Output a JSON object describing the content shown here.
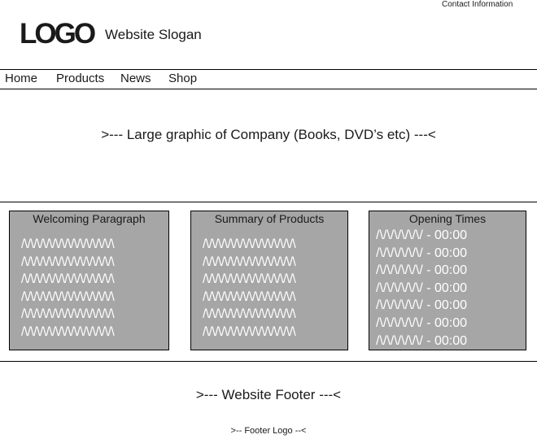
{
  "header": {
    "contact_label": "Contact Information",
    "logo_text": "LOGO",
    "slogan": "Website Slogan"
  },
  "nav": {
    "items": [
      {
        "label": "Home"
      },
      {
        "label": "Products"
      },
      {
        "label": "News"
      },
      {
        "label": "Shop"
      }
    ]
  },
  "hero": {
    "text": ">--- Large graphic of Company (Books, DVD’s etc) ---<"
  },
  "panels": [
    {
      "title": "Welcoming Paragraph",
      "lines": [
        "/\\/\\/\\/\\/\\/\\/\\/\\/\\/\\/\\/\\/\\/\\/\\",
        "/\\/\\/\\/\\/\\/\\/\\/\\/\\/\\/\\/\\/\\/\\/\\",
        "/\\/\\/\\/\\/\\/\\/\\/\\/\\/\\/\\/\\/\\/\\/\\",
        "/\\/\\/\\/\\/\\/\\/\\/\\/\\/\\/\\/\\/\\/\\/\\",
        "/\\/\\/\\/\\/\\/\\/\\/\\/\\/\\/\\/\\/\\/\\/\\",
        "/\\/\\/\\/\\/\\/\\/\\/\\/\\/\\/\\/\\/\\/\\/\\"
      ]
    },
    {
      "title": "Summary of Products",
      "lines": [
        "/\\/\\/\\/\\/\\/\\/\\/\\/\\/\\/\\/\\/\\/\\/\\",
        "/\\/\\/\\/\\/\\/\\/\\/\\/\\/\\/\\/\\/\\/\\/\\",
        "/\\/\\/\\/\\/\\/\\/\\/\\/\\/\\/\\/\\/\\/\\/\\",
        "/\\/\\/\\/\\/\\/\\/\\/\\/\\/\\/\\/\\/\\/\\/\\",
        "/\\/\\/\\/\\/\\/\\/\\/\\/\\/\\/\\/\\/\\/\\/\\",
        "/\\/\\/\\/\\/\\/\\/\\/\\/\\/\\/\\/\\/\\/\\/\\"
      ]
    },
    {
      "title": "Opening Times",
      "lines": [
        "/\\/\\/\\/\\/\\/\\/ - 00:00",
        "/\\/\\/\\/\\/\\/\\/ - 00:00",
        "/\\/\\/\\/\\/\\/\\/ - 00:00",
        "/\\/\\/\\/\\/\\/\\/ - 00:00",
        "/\\/\\/\\/\\/\\/\\/ - 00:00",
        "/\\/\\/\\/\\/\\/\\/ - 00:00",
        "/\\/\\/\\/\\/\\/\\/ - 00:00"
      ]
    }
  ],
  "footer": {
    "text": ">--- Website Footer ---<",
    "logo_text": ">-- Footer Logo --<"
  }
}
